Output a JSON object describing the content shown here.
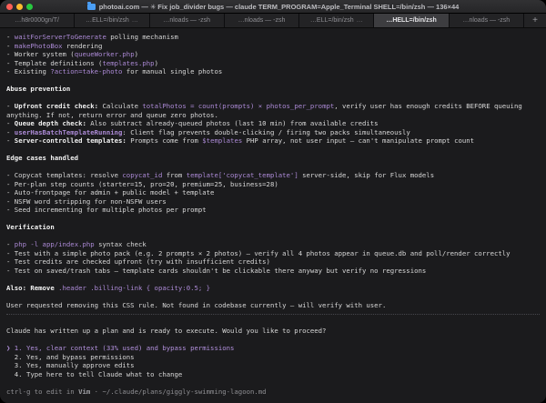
{
  "window": {
    "title": "photoai.com — ✳ Fix job_divider bugs — claude TERM_PROGRAM=Apple_Terminal SHELL=/bin/zsh — 136×44",
    "traffic_lights": {
      "close": "#ff5f57",
      "minimize": "#febc2e",
      "zoom": "#28c840"
    },
    "folder_icon_color": "#4a9ef5"
  },
  "tab_bar": {
    "tabs": [
      {
        "label": "…h8r0000gn/T/",
        "active": false,
        "activity": false
      },
      {
        "label": "…ELL=/bin/zsh",
        "active": false,
        "activity": true
      },
      {
        "label": "…nloads — -zsh",
        "active": false,
        "activity": false
      },
      {
        "label": "…nloads — -zsh",
        "active": false,
        "activity": false
      },
      {
        "label": "…ELL=/bin/zsh",
        "active": false,
        "activity": true
      },
      {
        "label": "…HELL=/bin/zsh",
        "active": true,
        "activity": false
      },
      {
        "label": "…nloads — -zsh",
        "active": false,
        "activity": false
      }
    ],
    "activity_indicator": "…",
    "new_tab_label": "+"
  },
  "colors": {
    "background": "#1b1b1d",
    "text_plain": "#d8d8d8",
    "text_bold": "#f2f2f2",
    "code_purple": "#ac8ad6",
    "selected_purple": "#b391de",
    "dim_gray": "#8f8f93"
  },
  "terminal": {
    "lines": [
      {
        "seg": [
          {
            "t": "- ",
            "s": "p"
          },
          {
            "t": "waitForServerToGenerate",
            "s": "c"
          },
          {
            "t": " polling mechanism",
            "s": "p"
          }
        ]
      },
      {
        "seg": [
          {
            "t": "- ",
            "s": "p"
          },
          {
            "t": "makePhotoBox",
            "s": "c"
          },
          {
            "t": " rendering",
            "s": "p"
          }
        ]
      },
      {
        "seg": [
          {
            "t": "- Worker system (",
            "s": "p"
          },
          {
            "t": "queueWorker.php",
            "s": "c"
          },
          {
            "t": ")",
            "s": "p"
          }
        ]
      },
      {
        "seg": [
          {
            "t": "- Template definitions (",
            "s": "p"
          },
          {
            "t": "templates.php",
            "s": "c"
          },
          {
            "t": ")",
            "s": "p"
          }
        ]
      },
      {
        "seg": [
          {
            "t": "- Existing ",
            "s": "p"
          },
          {
            "t": "?action=take-photo",
            "s": "c"
          },
          {
            "t": " for manual single photos",
            "s": "p"
          }
        ]
      },
      {
        "seg": []
      },
      {
        "name": "section-header-abuse-prevention",
        "seg": [
          {
            "t": "Abuse prevention",
            "s": "b"
          }
        ]
      },
      {
        "seg": []
      },
      {
        "seg": [
          {
            "t": "- ",
            "s": "p"
          },
          {
            "t": "Upfront credit check:",
            "s": "b"
          },
          {
            "t": " Calculate ",
            "s": "p"
          },
          {
            "t": "totalPhotos = count(prompts) × photos_per_prompt",
            "s": "c"
          },
          {
            "t": ", verify user has enough credits BEFORE queuing",
            "s": "p"
          }
        ]
      },
      {
        "seg": [
          {
            "t": "anything. If not, return error and queue zero photos.",
            "s": "p"
          }
        ]
      },
      {
        "seg": [
          {
            "t": "- ",
            "s": "p"
          },
          {
            "t": "Queue depth check:",
            "s": "b"
          },
          {
            "t": " Also subtract already-queued photos (last 10 min) from available credits",
            "s": "p"
          }
        ]
      },
      {
        "seg": [
          {
            "t": "- ",
            "s": "p"
          },
          {
            "t": "userHasBatchTemplateRunning",
            "s": "cb"
          },
          {
            "t": ": Client flag prevents double-clicking / firing two packs simultaneously",
            "s": "p"
          }
        ]
      },
      {
        "seg": [
          {
            "t": "- ",
            "s": "p"
          },
          {
            "t": "Server-controlled templates:",
            "s": "b"
          },
          {
            "t": " Prompts come from ",
            "s": "p"
          },
          {
            "t": "$templates",
            "s": "c"
          },
          {
            "t": " PHP array, not user input — can't manipulate prompt count",
            "s": "p"
          }
        ]
      },
      {
        "seg": []
      },
      {
        "name": "section-header-edge-cases",
        "seg": [
          {
            "t": "Edge cases handled",
            "s": "b"
          }
        ]
      },
      {
        "seg": []
      },
      {
        "seg": [
          {
            "t": "- Copycat templates: resolve ",
            "s": "p"
          },
          {
            "t": "copycat_id",
            "s": "c"
          },
          {
            "t": " from ",
            "s": "p"
          },
          {
            "t": "template['copycat_template']",
            "s": "c"
          },
          {
            "t": " server-side, skip for Flux models",
            "s": "p"
          }
        ]
      },
      {
        "seg": [
          {
            "t": "- Per-plan step counts (starter=15, pro=20, premium=25, business=28)",
            "s": "p"
          }
        ]
      },
      {
        "seg": [
          {
            "t": "- Auto-frontpage for admin + public model + template",
            "s": "p"
          }
        ]
      },
      {
        "seg": [
          {
            "t": "- NSFW word stripping for non-NSFW users",
            "s": "p"
          }
        ]
      },
      {
        "seg": [
          {
            "t": "- Seed incrementing for multiple photos per prompt",
            "s": "p"
          }
        ]
      },
      {
        "seg": []
      },
      {
        "name": "section-header-verification",
        "seg": [
          {
            "t": "Verification",
            "s": "b"
          }
        ]
      },
      {
        "seg": []
      },
      {
        "seg": [
          {
            "t": "- ",
            "s": "p"
          },
          {
            "t": "php -l app/index.php",
            "s": "c"
          },
          {
            "t": " syntax check",
            "s": "p"
          }
        ]
      },
      {
        "seg": [
          {
            "t": "- Test with a simple photo pack (e.g. 2 prompts × 2 photos) — verify all 4 photos appear in queue.db and poll/render correctly",
            "s": "p"
          }
        ]
      },
      {
        "seg": [
          {
            "t": "- Test credits are checked upfront (try with insufficient credits)",
            "s": "p"
          }
        ]
      },
      {
        "seg": [
          {
            "t": "- Test on saved/trash tabs — template cards shouldn't be clickable there anyway but verify no regressions",
            "s": "p"
          }
        ]
      },
      {
        "seg": []
      },
      {
        "seg": [
          {
            "t": "Also: Remove ",
            "s": "b"
          },
          {
            "t": ".header .billing-link { opacity:0.5; }",
            "s": "c"
          }
        ]
      },
      {
        "seg": []
      },
      {
        "seg": [
          {
            "t": "User requested removing this CSS rule. Not found in codebase currently — will verify with user.",
            "s": "p"
          }
        ]
      },
      {
        "type": "divider",
        "seg": []
      },
      {
        "seg": []
      },
      {
        "name": "proceed-question",
        "seg": [
          {
            "t": "Claude has written up a plan and is ready to execute. Would you like to proceed?",
            "s": "p"
          }
        ]
      },
      {
        "seg": []
      },
      {
        "name": "plan-option-1",
        "interactable": true,
        "seg": [
          {
            "t": "❯ 1. Yes, clear context (33% used) and bypass permissions",
            "s": "sel"
          }
        ]
      },
      {
        "name": "plan-option-2",
        "interactable": true,
        "seg": [
          {
            "t": "  2. Yes, and bypass permissions",
            "s": "p"
          }
        ]
      },
      {
        "name": "plan-option-3",
        "interactable": true,
        "seg": [
          {
            "t": "  3. Yes, manually approve edits",
            "s": "p"
          }
        ]
      },
      {
        "name": "plan-option-4",
        "interactable": true,
        "seg": [
          {
            "t": "  4. Type here to tell Claude what to change",
            "s": "p"
          }
        ]
      },
      {
        "seg": []
      },
      {
        "name": "vim-hint",
        "seg": [
          {
            "t": "ctrl-g",
            "s": "d"
          },
          {
            "t": " to edit in ",
            "s": "d"
          },
          {
            "t": "Vim",
            "s": "db"
          },
          {
            "t": " · ~/.claude/plans/giggly-swimming-lagoon.md",
            "s": "d"
          }
        ]
      }
    ]
  }
}
